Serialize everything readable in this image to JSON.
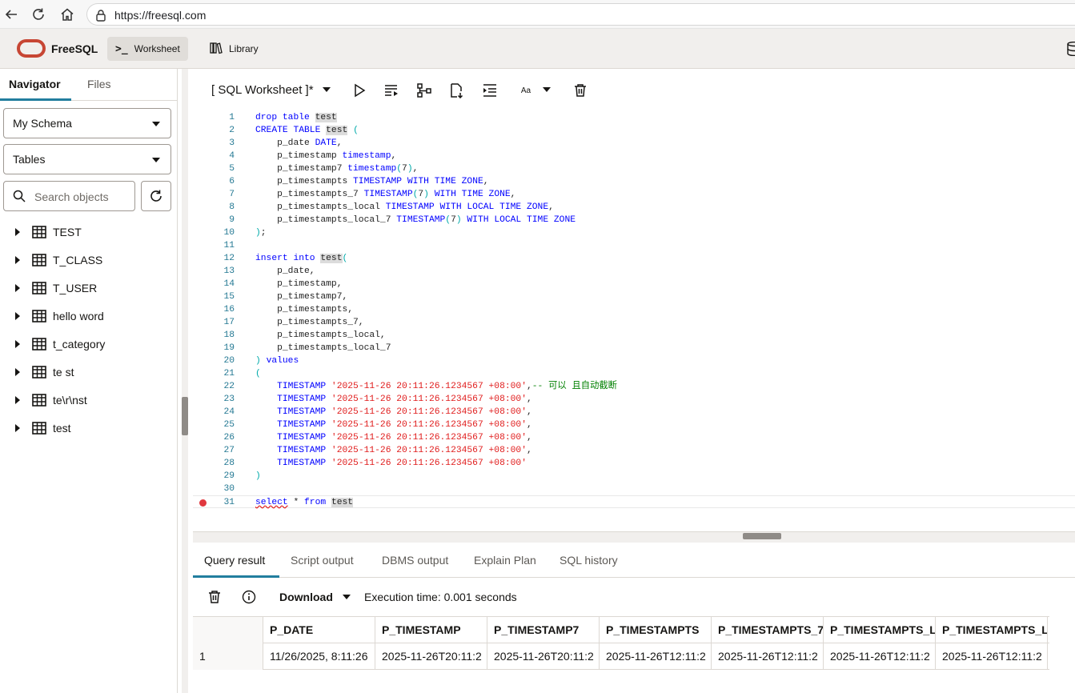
{
  "browser": {
    "url": "https://freesql.com"
  },
  "header": {
    "brand": "FreeSQL",
    "tabs": [
      {
        "label": "Worksheet"
      },
      {
        "label": "Library"
      }
    ]
  },
  "navigator": {
    "tabs": [
      {
        "label": "Navigator"
      },
      {
        "label": "Files"
      }
    ],
    "schema_select": "My Schema",
    "object_type_select": "Tables",
    "search_placeholder": "Search objects",
    "tables": [
      {
        "label": "TEST"
      },
      {
        "label": "T_CLASS"
      },
      {
        "label": "T_USER"
      },
      {
        "label": "hello word"
      },
      {
        "label": "t_category"
      },
      {
        "label": "te st"
      },
      {
        "label": "te\\r\\nst"
      },
      {
        "label": "test"
      }
    ]
  },
  "worksheet": {
    "title": "[ SQL Worksheet ]*",
    "font_size_label": "Aa"
  },
  "editor": {
    "lines": [
      [
        "drop table ",
        "test"
      ],
      [
        "CREATE TABLE ",
        "test",
        " ("
      ],
      [
        "    p_date DATE,"
      ],
      [
        "    p_timestamp timestamp,"
      ],
      [
        "    p_timestamp7 timestamp(7),"
      ],
      [
        "    p_timestampts TIMESTAMP WITH TIME ZONE,"
      ],
      [
        "    p_timestampts_7 TIMESTAMP(7) WITH TIME ZONE,"
      ],
      [
        "    p_timestampts_local TIMESTAMP WITH LOCAL TIME ZONE,"
      ],
      [
        "    p_timestampts_local_7 TIMESTAMP(7) WITH LOCAL TIME ZONE"
      ],
      [
        ");"
      ],
      [
        ""
      ],
      [
        "insert into ",
        "test",
        "("
      ],
      [
        "    p_date,"
      ],
      [
        "    p_timestamp,"
      ],
      [
        "    p_timestamp7,"
      ],
      [
        "    p_timestampts,"
      ],
      [
        "    p_timestampts_7,"
      ],
      [
        "    p_timestampts_local,"
      ],
      [
        "    p_timestampts_local_7"
      ],
      [
        ") values"
      ],
      [
        "("
      ],
      [
        "    TIMESTAMP '2025-11-26 20:11:26.1234567 +08:00',-- 可以 且自动截断"
      ],
      [
        "    TIMESTAMP '2025-11-26 20:11:26.1234567 +08:00',"
      ],
      [
        "    TIMESTAMP '2025-11-26 20:11:26.1234567 +08:00',"
      ],
      [
        "    TIMESTAMP '2025-11-26 20:11:26.1234567 +08:00',"
      ],
      [
        "    TIMESTAMP '2025-11-26 20:11:26.1234567 +08:00',"
      ],
      [
        "    TIMESTAMP '2025-11-26 20:11:26.1234567 +08:00',"
      ],
      [
        "    TIMESTAMP '2025-11-26 20:11:26.1234567 +08:00'"
      ],
      [
        ")"
      ],
      [
        ""
      ],
      [
        "select * from ",
        "test"
      ]
    ]
  },
  "results": {
    "tabs": [
      {
        "label": "Query result"
      },
      {
        "label": "Script output"
      },
      {
        "label": "DBMS output"
      },
      {
        "label": "Explain Plan"
      },
      {
        "label": "SQL history"
      }
    ],
    "download_label": "Download",
    "execution_time": "Execution time: 0.001 seconds",
    "columns": [
      "",
      "P_DATE",
      "P_TIMESTAMP",
      "P_TIMESTAMP7",
      "P_TIMESTAMPTS",
      "P_TIMESTAMPTS_7",
      "P_TIMESTAMPTS_LO",
      "P_TIMESTAMPTS_LO"
    ],
    "rows": [
      [
        "1",
        "11/26/2025, 8:11:26",
        "2025-11-26T20:11:2",
        "2025-11-26T20:11:2",
        "2025-11-26T12:11:2",
        "2025-11-26T12:11:2",
        "2025-11-26T12:11:2",
        "2025-11-26T12:11:2"
      ]
    ]
  },
  "colors": {
    "accent": "#227e9e",
    "brand": "#c74634",
    "keyword": "#0000ff",
    "string": "#e01b1b",
    "comment": "#008000"
  }
}
